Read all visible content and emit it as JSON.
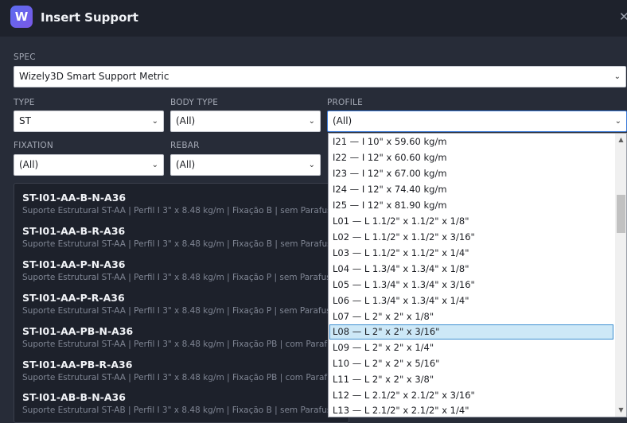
{
  "window": {
    "logo_letter": "W",
    "title": "Insert Support",
    "close_glyph": "✕"
  },
  "form": {
    "spec": {
      "label": "SPEC",
      "value": "Wizely3D Smart Support Metric"
    },
    "type": {
      "label": "TYPE",
      "value": "ST"
    },
    "body_type": {
      "label": "BODY TYPE",
      "value": "(All)"
    },
    "profile": {
      "label": "PROFILE",
      "value": "(All)"
    },
    "fixation": {
      "label": "FIXATION",
      "value": "(All)"
    },
    "rebar": {
      "label": "REBAR",
      "value": "(All)"
    }
  },
  "results": [
    {
      "code": "ST-I01-AA-B-N-A36",
      "desc": "Suporte Estrutural ST-AA | Perfil I 3\" x 8.48 kg/m | Fixação B | sem Parafusos | se"
    },
    {
      "code": "ST-I01-AA-B-R-A36",
      "desc": "Suporte Estrutural ST-AA | Perfil I 3\" x 8.48 kg/m | Fixação B | sem Parafusos | co"
    },
    {
      "code": "ST-I01-AA-P-N-A36",
      "desc": "Suporte Estrutural ST-AA | Perfil I 3\" x 8.48 kg/m | Fixação P | sem Parafusos | se"
    },
    {
      "code": "ST-I01-AA-P-R-A36",
      "desc": "Suporte Estrutural ST-AA | Perfil I 3\" x 8.48 kg/m | Fixação P | sem Parafusos | co"
    },
    {
      "code": "ST-I01-AA-PB-N-A36",
      "desc": "Suporte Estrutural ST-AA | Perfil I 3\" x 8.48 kg/m | Fixação PB | com Parafusos | s"
    },
    {
      "code": "ST-I01-AA-PB-R-A36",
      "desc": "Suporte Estrutural ST-AA | Perfil I 3\" x 8.48 kg/m | Fixação PB | com Parafusos | c"
    },
    {
      "code": "ST-I01-AB-B-N-A36",
      "desc": "Suporte Estrutural ST-AB | Perfil I 3\" x 8.48 kg/m | Fixação B | sem Parafusos | se"
    }
  ],
  "profile_dropdown": {
    "selected_index": 12,
    "options": [
      "I21 — I 10\" x 59.60 kg/m",
      "I22 — I 12\" x 60.60 kg/m",
      "I23 — I 12\" x 67.00 kg/m",
      "I24 — I 12\" x 74.40 kg/m",
      "I25 — I 12\" x 81.90 kg/m",
      "L01 — L 1.1/2\" x 1.1/2\" x 1/8\"",
      "L02 — L 1.1/2\" x 1.1/2\" x 3/16\"",
      "L03 — L 1.1/2\" x 1.1/2\" x 1/4\"",
      "L04 — L 1.3/4\" x 1.3/4\" x 1/8\"",
      "L05 — L 1.3/4\" x 1.3/4\" x 3/16\"",
      "L06 — L 1.3/4\" x 1.3/4\" x 1/4\"",
      "L07 — L 2\" x 2\" x 1/8\"",
      "L08 — L 2\" x 2\" x 3/16\"",
      "L09 — L 2\" x 2\" x 1/4\"",
      "L10 — L 2\" x 2\" x 5/16\"",
      "L11 — L 2\" x 2\" x 3/8\"",
      "L12 — L 2.1/2\" x 2.1/2\" x 3/16\"",
      "L13 — L 2.1/2\" x 2.1/2\" x 1/4\""
    ]
  }
}
